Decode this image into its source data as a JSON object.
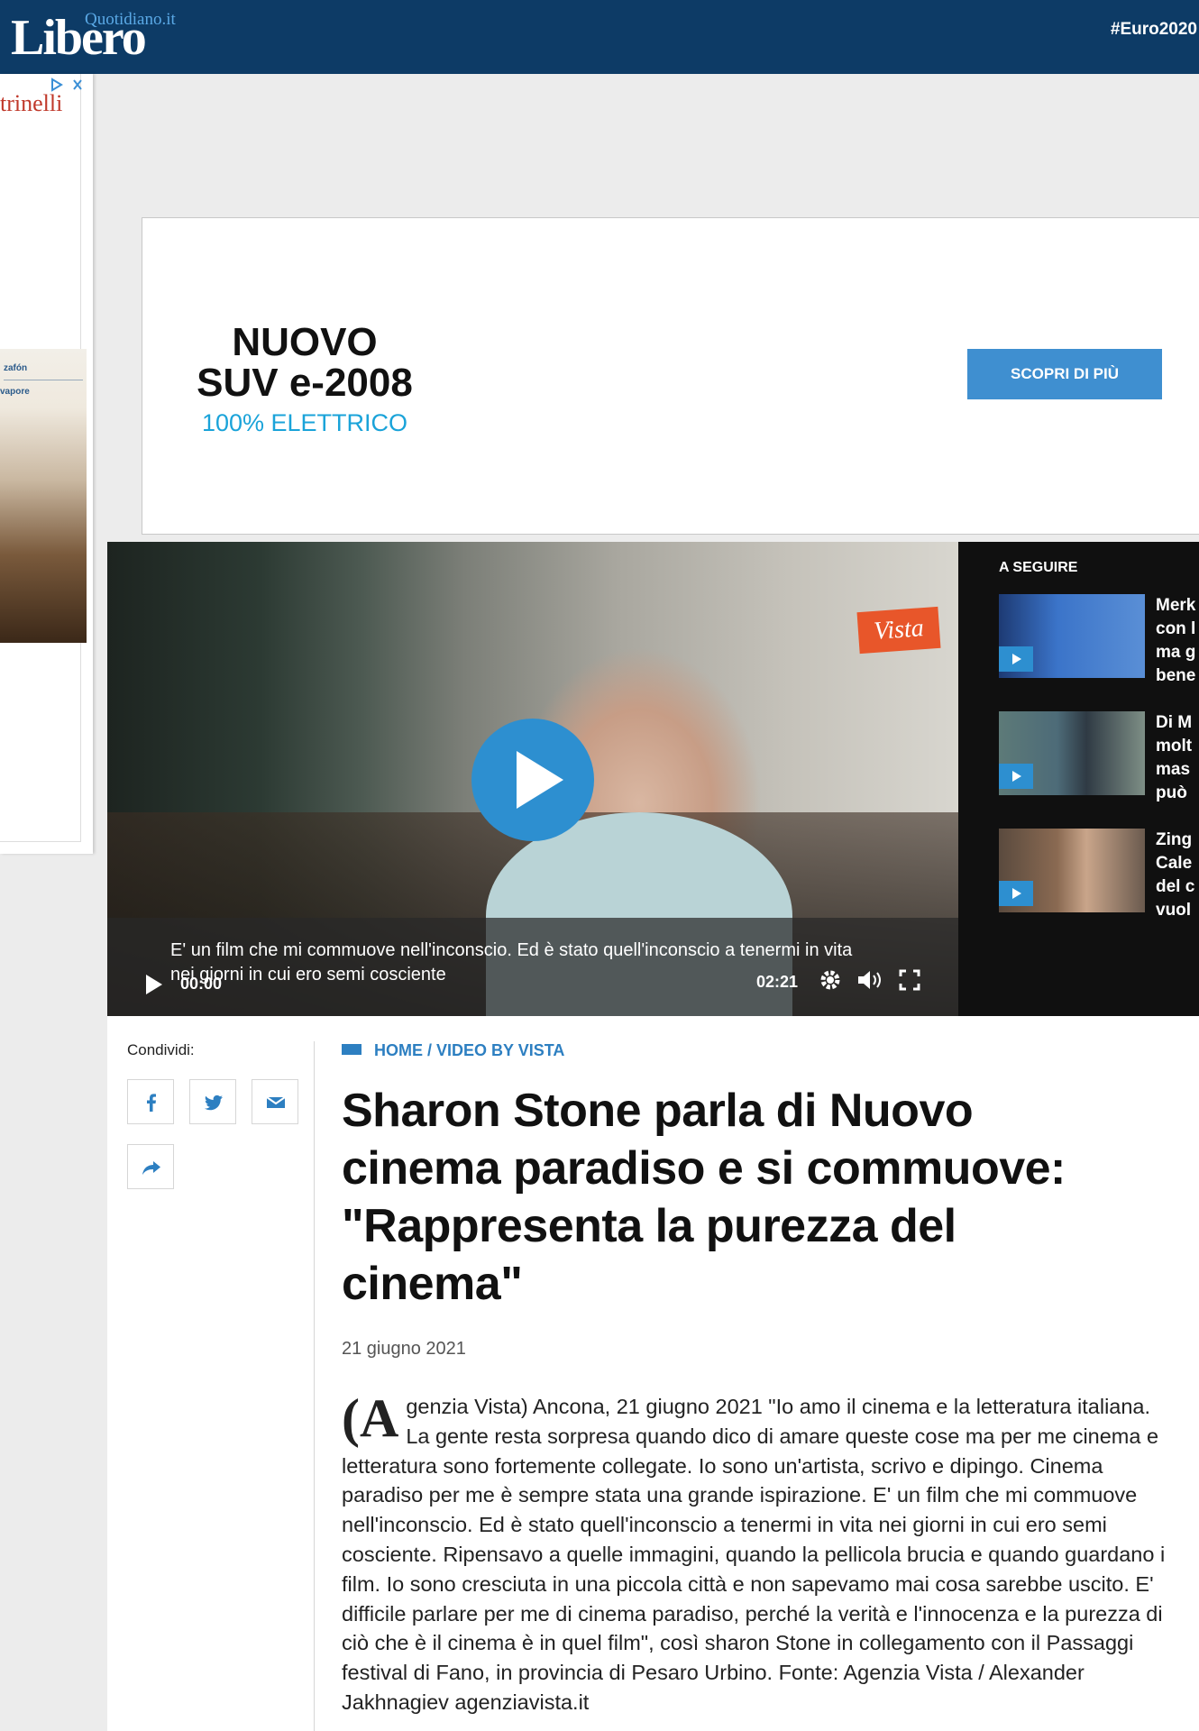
{
  "header": {
    "logo_main": "Libero",
    "logo_sub": "Quotidiano.it",
    "hashtag": "#Euro2020"
  },
  "side_ad": {
    "brand": "trinelli",
    "book_line1": "zafón",
    "book_line2": "vapore"
  },
  "banner_ad": {
    "title_line1": "NUOVO",
    "title_line2": "SUV e-2008",
    "subtitle": "100% ELETTRICO",
    "button": "SCOPRI DI PIÙ"
  },
  "player": {
    "watermark": "Vista",
    "subtitle_line1": "E' un film che mi commuove nell'inconscio. Ed è stato quell'inconscio a tenermi in vita",
    "subtitle_line2": "nei giorni in cui ero semi cosciente",
    "time_current": "00:00",
    "time_total": "02:21"
  },
  "up_next": {
    "title": "A SEGUIRE",
    "items": [
      {
        "text": "Merk\ncon l\nma g\nbene",
        "thumb_color": "#3b74c9"
      },
      {
        "text": "Di M\nmolt\nmas\npuò",
        "thumb_color": "#4d6b78"
      },
      {
        "text": "Zing\nCale\ndel c\nvuol",
        "thumb_color": "#8a6a52"
      }
    ]
  },
  "article": {
    "share_label": "Condividi:",
    "breadcrumb_home": "HOME",
    "breadcrumb_section": "/ VIDEO BY VISTA",
    "headline": "Sharon Stone parla di Nuovo cinema paradiso e si commuove: \"Rappresenta la purezza del cinema\"",
    "date": "21 giugno 2021",
    "dropcap": "(A",
    "body": "genzia Vista) Ancona, 21 giugno 2021 \"Io amo il cinema e la letteratura italiana. La gente resta sorpresa quando dico di amare queste cose ma per me cinema e letteratura sono fortemente collegate. Io sono un'artista, scrivo e dipingo. Cinema paradiso per me è sempre stata una grande ispirazione. E' un film che mi commuove nell'inconscio. Ed è stato quell'inconscio a tenermi in vita nei giorni in cui ero semi cosciente. Ripensavo a quelle immagini, quando la pellicola brucia e quando guardano i film. Io sono cresciuta in una piccola città e non sapevamo mai cosa sarebbe uscito. E' difficile parlare per me di cinema paradiso, perché la verità e l'innocenza e la purezza di ciò che è il cinema è in quel film\", così sharon Stone in collegamento con il Passaggi festival di Fano, in provincia di Pesaro Urbino. Fonte: Agenzia Vista / Alexander Jakhnagiev agenziavista.it"
  },
  "colors": {
    "header_bg": "#0d3b66",
    "accent_blue": "#2d7fc1",
    "play_button": "#2d8fd0"
  }
}
